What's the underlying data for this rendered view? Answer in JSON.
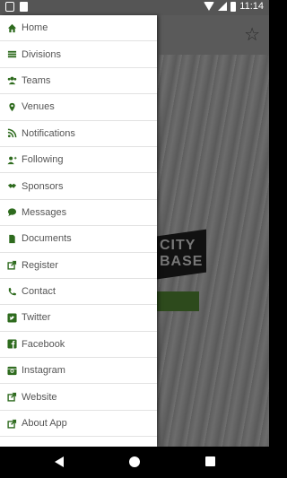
{
  "status_bar": {
    "time": "11:14"
  },
  "accent_color": "#2e6b1e",
  "menu": [
    {
      "label": "Home",
      "icon": "home-icon"
    },
    {
      "label": "Divisions",
      "icon": "list-icon"
    },
    {
      "label": "Teams",
      "icon": "users-icon"
    },
    {
      "label": "Venues",
      "icon": "map-marker-icon"
    },
    {
      "label": "Notifications",
      "icon": "rss-icon"
    },
    {
      "label": "Following",
      "icon": "user-plus-icon"
    },
    {
      "label": "Sponsors",
      "icon": "handshake-icon"
    },
    {
      "label": "Messages",
      "icon": "chat-bubble-icon"
    },
    {
      "label": "Documents",
      "icon": "file-icon"
    },
    {
      "label": "Register",
      "icon": "external-link-icon"
    },
    {
      "label": "Contact",
      "icon": "phone-icon"
    },
    {
      "label": "Twitter",
      "icon": "twitter-icon"
    },
    {
      "label": "Facebook",
      "icon": "facebook-icon"
    },
    {
      "label": "Instagram",
      "icon": "instagram-icon"
    },
    {
      "label": "Website",
      "icon": "external-link-icon"
    },
    {
      "label": "About App",
      "icon": "external-link-icon"
    }
  ],
  "background_logo_text": [
    "CITY",
    "BASE"
  ]
}
